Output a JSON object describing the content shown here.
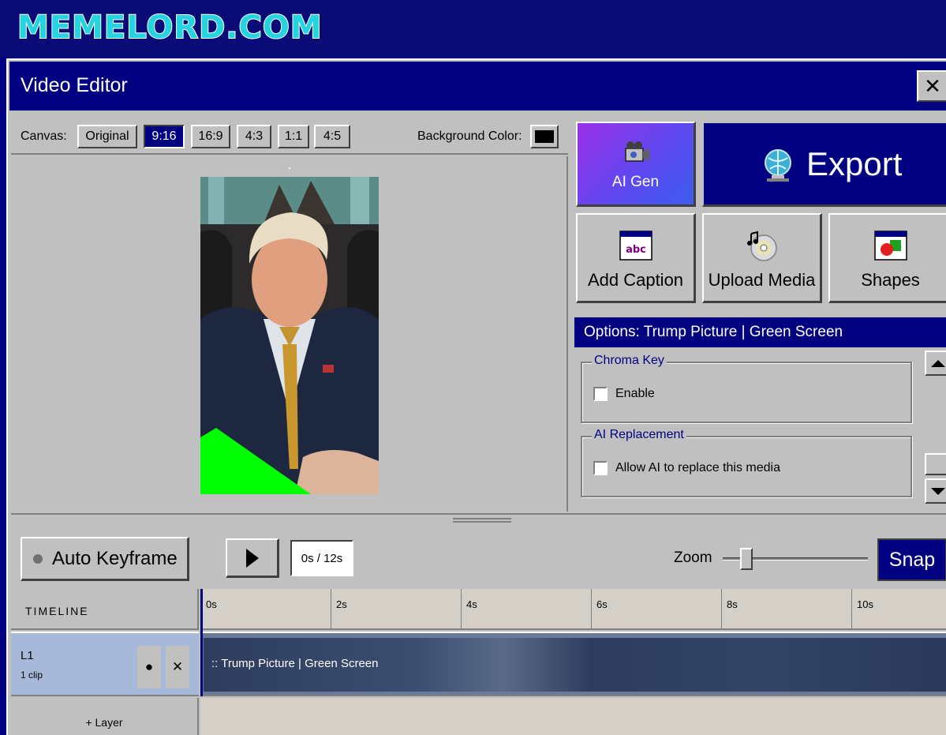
{
  "brand": {
    "logo": "MEMELORD.COM"
  },
  "window": {
    "title": "Video Editor",
    "close_label": "✕"
  },
  "canvas": {
    "label": "Canvas:",
    "ratios": [
      "Original",
      "9:16",
      "16:9",
      "4:3",
      "1:1",
      "4:5"
    ],
    "selected": "9:16",
    "background_label": "Background Color:",
    "background_color": "#000000"
  },
  "actions": {
    "ai_gen": "AI Gen",
    "export": "Export",
    "add_caption": "Add Caption",
    "upload_media": "Upload Media",
    "shapes": "Shapes",
    "caption_icon_text": "abc"
  },
  "options": {
    "title": "Options: Trump Picture | Green Screen",
    "chroma_key": {
      "title": "Chroma Key",
      "checkbox_label": "Enable",
      "checked": false
    },
    "ai_replacement": {
      "title": "AI Replacement",
      "checkbox_label": "Allow AI to replace this media",
      "checked": false
    }
  },
  "controls": {
    "auto_keyframe": "Auto Keyframe",
    "time_display": "0s / 12s",
    "zoom_label": "Zoom",
    "zoom_level": 0.1,
    "snap": "Snap"
  },
  "timeline": {
    "header": "TIMELINE",
    "ticks": [
      "0s",
      "2s",
      "4s",
      "6s",
      "8s",
      "10s"
    ],
    "layers": [
      {
        "name": "L1",
        "count": "1 clip",
        "clip_label": "::  Trump Picture | Green Screen"
      }
    ],
    "add_layer": "+ Layer"
  },
  "colors": {
    "accent": "#000080",
    "window_bg": "#c0c0c0",
    "ai_gradient_start": "#9b30e8",
    "ai_gradient_end": "#3d5cf0",
    "green_screen": "#00ff00",
    "logo": "#26d3e0"
  },
  "icons": [
    "video-camera-icon",
    "globe-monitor-icon",
    "caption-window-icon",
    "cd-music-icon",
    "shapes-window-icon",
    "play-icon",
    "scroll-up-icon",
    "scroll-down-icon"
  ]
}
